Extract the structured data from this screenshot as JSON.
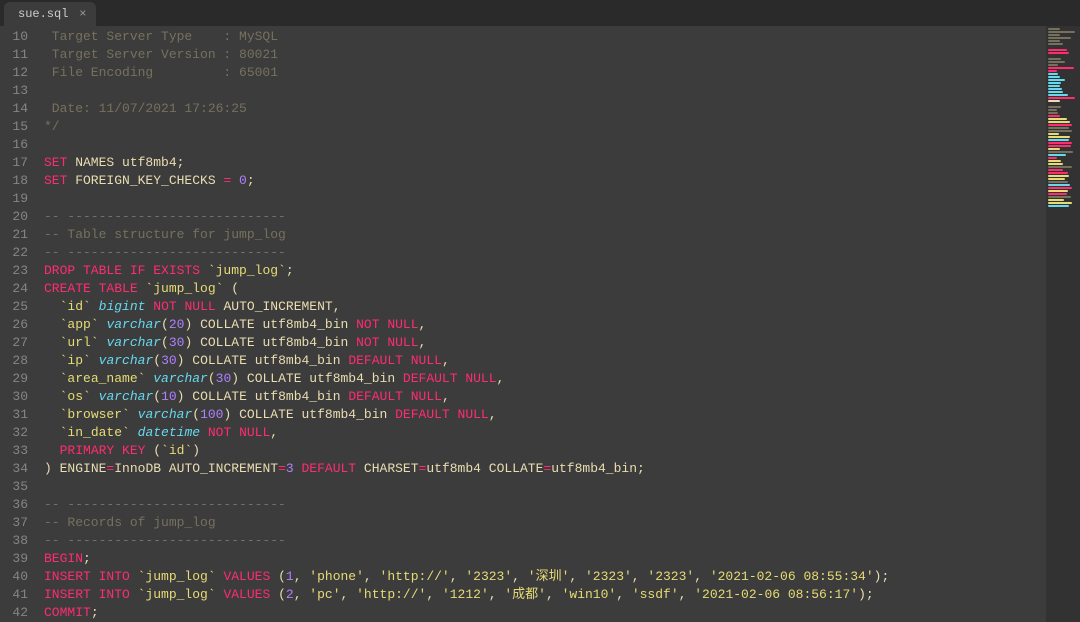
{
  "tab": {
    "filename": "sue.sql",
    "close": "×"
  },
  "first_line_no": 10,
  "lines": [
    {
      "t": "comment",
      "text": " Target Server Type    : MySQL"
    },
    {
      "t": "comment",
      "text": " Target Server Version : 80021"
    },
    {
      "t": "comment",
      "text": " File Encoding         : 65001"
    },
    {
      "t": "comment",
      "text": ""
    },
    {
      "t": "comment",
      "text": " Date: 11/07/2021 17:26:25"
    },
    {
      "t": "comment",
      "text": "*/"
    },
    {
      "t": "blank",
      "text": ""
    },
    {
      "t": "set1",
      "kw": "SET",
      "rest": " NAMES utf8mb4;"
    },
    {
      "t": "set2",
      "kw": "SET",
      "rest1": " FOREIGN_KEY_CHECKS ",
      "eq": "=",
      "num": " 0",
      "semi": ";"
    },
    {
      "t": "blank",
      "text": ""
    },
    {
      "t": "comment",
      "text": "-- ----------------------------"
    },
    {
      "t": "comment",
      "text": "-- Table structure for jump_log"
    },
    {
      "t": "comment",
      "text": "-- ----------------------------"
    },
    {
      "t": "drop",
      "kw": "DROP TABLE IF EXISTS",
      "bt": " `jump_log`",
      "semi": ";"
    },
    {
      "t": "create",
      "kw": "CREATE TABLE",
      "bt": " `jump_log`",
      "paren": " ("
    },
    {
      "t": "col_id",
      "indent": "  ",
      "bt": "`id`",
      "sp1": " ",
      "type": "bigint",
      "sp2": " ",
      "kw": "NOT NULL",
      "rest": " AUTO_INCREMENT,"
    },
    {
      "t": "col_v",
      "indent": "  ",
      "bt": "`app`",
      "sp1": " ",
      "type": "varchar",
      "p1": "(",
      "num": "20",
      "p2": ")",
      "coll": " COLLATE utf8mb4_bin ",
      "kw": "NOT NULL",
      "comma": ","
    },
    {
      "t": "col_v",
      "indent": "  ",
      "bt": "`url`",
      "sp1": " ",
      "type": "varchar",
      "p1": "(",
      "num": "30",
      "p2": ")",
      "coll": " COLLATE utf8mb4_bin ",
      "kw": "NOT NULL",
      "comma": ","
    },
    {
      "t": "col_vd",
      "indent": "  ",
      "bt": "`ip`",
      "sp1": " ",
      "type": "varchar",
      "p1": "(",
      "num": "30",
      "p2": ")",
      "coll": " COLLATE utf8mb4_bin ",
      "kw": "DEFAULT NULL",
      "comma": ","
    },
    {
      "t": "col_vd",
      "indent": "  ",
      "bt": "`area_name`",
      "sp1": " ",
      "type": "varchar",
      "p1": "(",
      "num": "30",
      "p2": ")",
      "coll": " COLLATE utf8mb4_bin ",
      "kw": "DEFAULT NULL",
      "comma": ","
    },
    {
      "t": "col_vd",
      "indent": "  ",
      "bt": "`os`",
      "sp1": " ",
      "type": "varchar",
      "p1": "(",
      "num": "10",
      "p2": ")",
      "coll": " COLLATE utf8mb4_bin ",
      "kw": "DEFAULT NULL",
      "comma": ","
    },
    {
      "t": "col_vd",
      "indent": "  ",
      "bt": "`browser`",
      "sp1": " ",
      "type": "varchar",
      "p1": "(",
      "num": "100",
      "p2": ")",
      "coll": " COLLATE utf8mb4_bin ",
      "kw": "DEFAULT NULL",
      "comma": ","
    },
    {
      "t": "col_dt",
      "indent": "  ",
      "bt": "`in_date`",
      "sp1": " ",
      "type": "datetime",
      "sp2": " ",
      "kw": "NOT NULL",
      "comma": ","
    },
    {
      "t": "pk",
      "indent": "  ",
      "kw": "PRIMARY KEY",
      "rest": " (",
      "bt": "`id`",
      "rest2": ")"
    },
    {
      "t": "engine",
      "p1": ") ",
      "e": "ENGINE",
      "eq1": "=",
      "v1": "InnoDB ",
      "ai": "AUTO_INCREMENT",
      "eq2": "=",
      "n": "3",
      "sp": " ",
      "def": "DEFAULT",
      "cs": " CHARSET",
      "eq3": "=",
      "v2": "utf8mb4 ",
      "col": "COLLATE",
      "eq4": "=",
      "v3": "utf8mb4_bin;"
    },
    {
      "t": "blank",
      "text": ""
    },
    {
      "t": "comment",
      "text": "-- ----------------------------"
    },
    {
      "t": "comment",
      "text": "-- Records of jump_log"
    },
    {
      "t": "comment",
      "text": "-- ----------------------------"
    },
    {
      "t": "kwline",
      "kw": "BEGIN",
      "semi": ";"
    },
    {
      "t": "insert",
      "kw": "INSERT INTO",
      "bt": " `jump_log`",
      "kw2": " VALUES",
      "p1": " (",
      "n": "1",
      "values": [
        "'phone'",
        "'http://'",
        "'2323'",
        "'深圳'",
        "'2323'",
        "'2323'",
        "'2021-02-06 08:55:34'"
      ],
      "p2": ");"
    },
    {
      "t": "insert",
      "kw": "INSERT INTO",
      "bt": " `jump_log`",
      "kw2": " VALUES",
      "p1": " (",
      "n": "2",
      "values": [
        "'pc'",
        "'http://'",
        "'1212'",
        "'成都'",
        "'win10'",
        "'ssdf'",
        "'2021-02-06 08:56:17'"
      ],
      "p2": ");"
    },
    {
      "t": "kwline",
      "kw": "COMMIT",
      "semi": ";"
    }
  ],
  "minimap_colors": [
    "#76715e",
    "#76715e",
    "#76715e",
    "#76715e",
    "#76715e",
    "#76715e",
    "",
    "#ff2c70",
    "#ff2c70",
    "",
    "#76715e",
    "#76715e",
    "#76715e",
    "#ff2c70",
    "#ff2c70",
    "#66d9ef",
    "#66d9ef",
    "#66d9ef",
    "#66d9ef",
    "#66d9ef",
    "#66d9ef",
    "#66d9ef",
    "#66d9ef",
    "#ff2c70",
    "#eaddb2",
    "",
    "#76715e",
    "#76715e",
    "#76715e",
    "#ff2c70",
    "#e6db74",
    "#e6db74",
    "#ff2c70",
    "#76715e",
    "#76715e",
    "#e6db74",
    "#e6db74",
    "#66d9ef",
    "#ff2c70",
    "#ff2c70",
    "#e6db74",
    "#76715e",
    "#66d9ef",
    "#ff2c70",
    "#e6db74",
    "#e6db74",
    "#76715e",
    "#ff2c70",
    "#ff2c70",
    "#e6db74",
    "#e6db74",
    "#76715e",
    "#66d9ef",
    "#ff2c70",
    "#e6db74",
    "#ff2c70",
    "#76715e",
    "#e6db74",
    "#e6db74",
    "#66d9ef"
  ]
}
